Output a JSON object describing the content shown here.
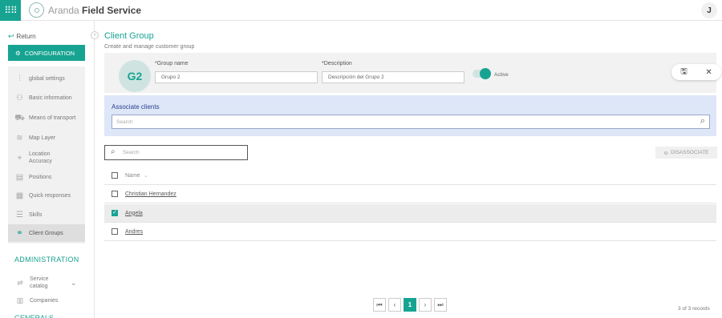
{
  "app": {
    "brand_light": "Aranda",
    "brand_bold": "Field Service",
    "user_initial": "J",
    "accent": "#17a392"
  },
  "sidebar": {
    "return_label": "Return",
    "config_label": "CONFIGURATION",
    "items": [
      {
        "label": "global settings",
        "icon": "sliders-icon"
      },
      {
        "label": "Basic information",
        "icon": "info-icon"
      },
      {
        "label": "Means of transport",
        "icon": "truck-icon"
      },
      {
        "label": "Map Layer",
        "icon": "layers-icon"
      },
      {
        "label": "Location Accuracy",
        "icon": "pin-icon"
      },
      {
        "label": "Positions",
        "icon": "positions-icon"
      },
      {
        "label": "Quick responses",
        "icon": "document-icon"
      },
      {
        "label": "Skills",
        "icon": "skills-icon"
      },
      {
        "label": "Client Groups",
        "icon": "client-groups-icon"
      }
    ],
    "admin_title": "ADMINISTRATION",
    "admin_items": [
      {
        "label": "Service catalog",
        "icon": "catalog-icon"
      },
      {
        "label": "Companies",
        "icon": "building-icon"
      }
    ],
    "next_section": "GENERALS"
  },
  "page": {
    "title": "Client Group",
    "subtitle": "Create and manage customer group"
  },
  "form": {
    "avatar": "G2",
    "group_name_label": "*Group name",
    "group_name_value": "Grupo 2",
    "description_label": "*Description",
    "description_value": "Descripción del Grupo 2",
    "active_label": "Active",
    "active": true
  },
  "associate": {
    "title": "Associate clients",
    "placeholder": "Search"
  },
  "list": {
    "search_placeholder": "Search",
    "disassociate_label": "DISASSOCIATE",
    "header_name": "Name",
    "rows": [
      {
        "name": "Christian Hernandez",
        "checked": false
      },
      {
        "name": "Angela",
        "checked": true
      },
      {
        "name": "Andres",
        "checked": false
      }
    ]
  },
  "pagination": {
    "current_page": "1",
    "records": "3 of 3 records"
  }
}
